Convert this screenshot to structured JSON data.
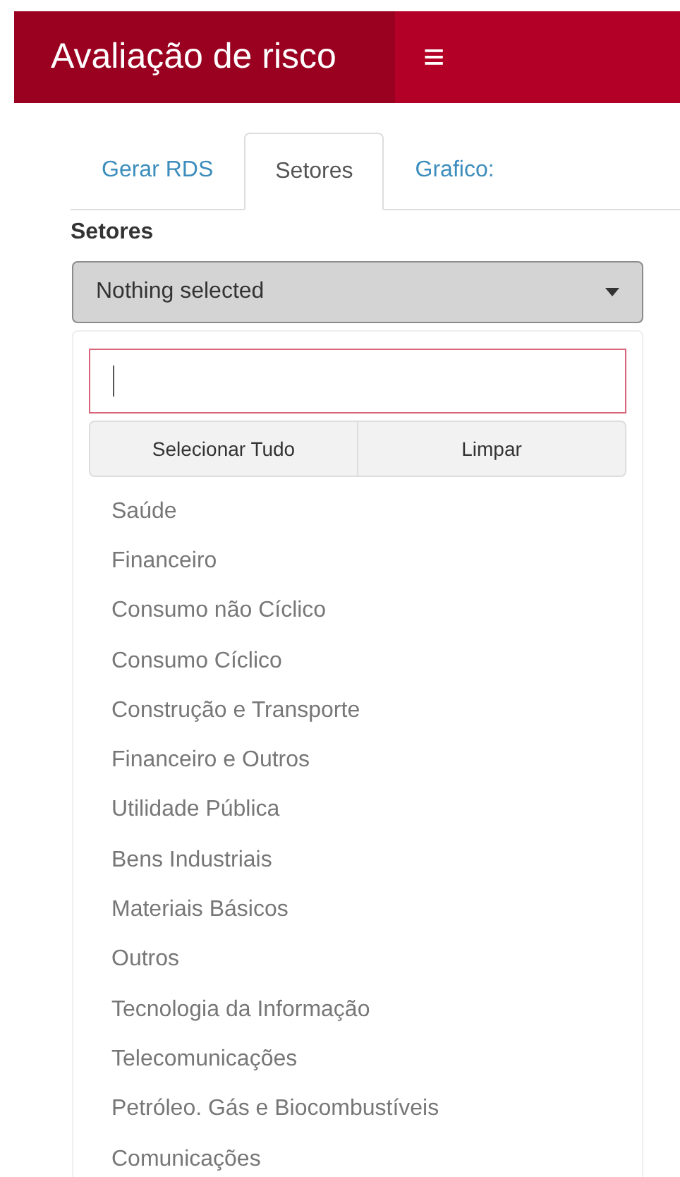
{
  "header": {
    "title": "Avaliação de risco",
    "menu_icon": "≡"
  },
  "tabs": [
    {
      "label": "Gerar RDS",
      "selected": false
    },
    {
      "label": "Setores",
      "selected": true
    },
    {
      "label": "Grafico:",
      "selected": false
    }
  ],
  "field_label": "Setores",
  "select": {
    "value": "Nothing selected",
    "expanded": true
  },
  "dropdown": {
    "search": {
      "focused": true
    },
    "actions": [
      "Selecionar Tudo",
      "Limpar"
    ],
    "options": [
      "Saúde",
      "Financeiro",
      "Consumo não Cíclico",
      "Consumo Cíclico",
      "Construção e Transporte",
      "Financeiro e Outros",
      "Utilidade Pública",
      "Bens Industriais",
      "Materiais Básicos",
      "Outros",
      "Tecnologia da Informação",
      "Telecomunicações",
      "Petróleo. Gás e Biocombustíveis",
      "Comunicações"
    ]
  }
}
